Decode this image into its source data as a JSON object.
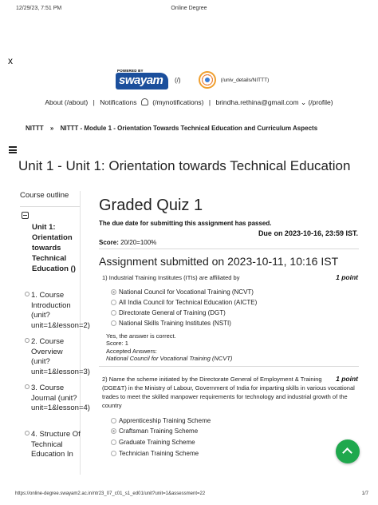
{
  "print_header": {
    "datetime": "12/29/23, 7:51 PM",
    "title": "Online Degree"
  },
  "close_label": "x",
  "logos": {
    "swayam_powered": "POWERED BY",
    "swayam_word": "swayam",
    "swayam_link": "(/)",
    "nittt_link": "(/univ_details/NITTT)"
  },
  "top_nav": {
    "about": "About (/about)",
    "notifications": "Notifications",
    "notifications_link": "(/mynotifications)",
    "user": "brindha.rethina@gmail.com",
    "profile_link": "(/profile)",
    "separator": "|"
  },
  "breadcrumb": {
    "root": "NITTT",
    "separator": "»",
    "current": "NITTT - Module 1 - Orientation Towards Technical Education and Curriculum Aspects"
  },
  "unit_title": "Unit 1 - Unit 1: Orientation towards Technical Education",
  "sidebar": {
    "outline_title": "Course outline",
    "unit_heading": "Unit 1: Orientation towards Technical Education ()",
    "lessons": [
      "1. Course Introduction (unit?unit=1&lesson=2)",
      "2. Course Overview (unit?unit=1&lesson=3)",
      "3. Course Journal (unit?unit=1&lesson=4)",
      "4. Structure Of Technical Education In"
    ]
  },
  "quiz": {
    "title": "Graded Quiz 1",
    "due_passed": "The due date for submitting this assignment has passed.",
    "due_date": "Due on 2023-10-16, 23:59 IST.",
    "score_label": "Score:",
    "score_value": "20/20=100%",
    "submitted": "Assignment submitted on 2023-10-11, 10:16 IST",
    "questions": [
      {
        "text": "1)  Industrial Training Institutes (ITIs) are affiliated by",
        "point": "1 point",
        "options": [
          "National Council for Vocational Training (NCVT)",
          "All India Council for Technical Education (AICTE)",
          "Directorate General of Training (DGT)",
          "National Skills Training Institutes (NSTI)"
        ],
        "selected": 0,
        "feedback": "Yes, the answer is correct.",
        "score": "Score: 1",
        "accepted_label": "Accepted Answers:",
        "accepted": "National Council for Vocational Training (NCVT)"
      },
      {
        "text_1": "2)  Name the scheme initiated by the Directorate General of Employment & Training",
        "text_2": "(DGE&T) in the Ministry of Labour, Government of India for imparting skills in various vocational",
        "text_3": "trades to meet the skilled manpower requirements for technology and industrial growth of the",
        "text_4": "country",
        "point": "1 point",
        "options": [
          "Apprenticeship Training Scheme",
          "Craftsman Training Scheme",
          "Graduate Training Scheme",
          "Technician Training Scheme"
        ],
        "selected": 1
      }
    ]
  },
  "print_footer": {
    "url": "https://online-degree.swayam2.ac.in/ntr23_07_c01_s1_ed01/unit?unit=1&assessment=22",
    "page": "1/7"
  },
  "colors": {
    "swayam_blue": "#1b4f9c",
    "fab_green": "#1fa84d"
  }
}
